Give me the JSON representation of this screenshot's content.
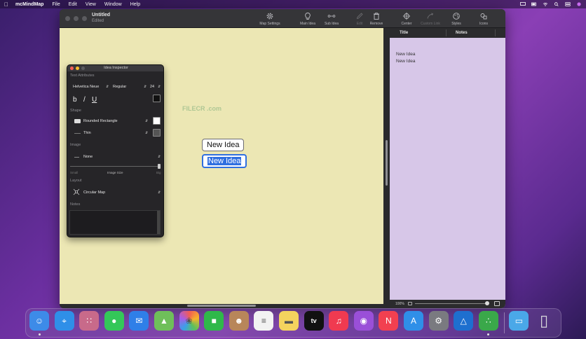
{
  "menubar": {
    "app": "mcMindMap",
    "items": [
      "File",
      "Edit",
      "View",
      "Window",
      "Help"
    ]
  },
  "window": {
    "title": "Untitled",
    "subtitle": "Edited",
    "toolbar": [
      {
        "label": "Map Settings",
        "icon": "gear-icon",
        "enabled": true
      },
      {
        "label": "Main Idea",
        "icon": "lightbulb-icon",
        "enabled": true
      },
      {
        "label": "Sub Idea",
        "icon": "sub-idea-icon",
        "enabled": true
      },
      {
        "label": "Edit",
        "icon": "pen-icon",
        "enabled": false
      },
      {
        "label": "Remove",
        "icon": "trash-icon",
        "enabled": true
      },
      {
        "label": "Center",
        "icon": "crosshair-icon",
        "enabled": true
      },
      {
        "label": "Custom Link",
        "icon": "link-arrow-icon",
        "enabled": false
      },
      {
        "label": "Styles",
        "icon": "palette-icon",
        "enabled": true
      },
      {
        "label": "Icons",
        "icon": "icons-icon",
        "enabled": true
      }
    ]
  },
  "canvas": {
    "nodes": [
      "New Idea",
      "New Idea"
    ],
    "watermark": "FILECR .com",
    "background": "#ece7b4"
  },
  "notes_panel": {
    "columns": [
      "Title",
      "Notes"
    ],
    "rows": [
      "New Idea",
      "New Idea"
    ],
    "zoom": "100%"
  },
  "inspector": {
    "title": "Idea Inspector",
    "text_attributes_label": "Text Attributes",
    "font": "Helvetica Neue",
    "weight": "Regular",
    "size": "24",
    "bold": "b",
    "italic": "/",
    "underline": "U",
    "shape_label": "Shape",
    "shape": "Rounded Rectangle",
    "line": "Thin",
    "image_label": "Image",
    "image": "None",
    "image_size_small": "Small",
    "image_size_label": "Image Size",
    "image_size_big": "Big",
    "layout_label": "Layout",
    "layout": "Circular Map",
    "notes_label": "Notes"
  },
  "dock": [
    {
      "name": "finder",
      "icon": "finder-icon",
      "color": "#3d8be8",
      "running": true
    },
    {
      "name": "safari",
      "icon": "compass-icon",
      "color": "#2f8fe8",
      "running": false
    },
    {
      "name": "launchpad",
      "icon": "grid-icon",
      "color": "#c86a8a",
      "running": false
    },
    {
      "name": "messages",
      "icon": "chat-bubble-icon",
      "color": "#34c759",
      "running": false
    },
    {
      "name": "mail",
      "icon": "envelope-icon",
      "color": "#2f7fe8",
      "running": false
    },
    {
      "name": "maps",
      "icon": "map-pin-icon",
      "color": "#6fbf5a",
      "running": false
    },
    {
      "name": "photos",
      "icon": "flower-icon",
      "color": "#f4f4f4",
      "running": false
    },
    {
      "name": "facetime",
      "icon": "camera-icon",
      "color": "#2fb84a",
      "running": false
    },
    {
      "name": "contacts",
      "icon": "person-icon",
      "color": "#b8865a",
      "running": false
    },
    {
      "name": "reminders",
      "icon": "checklist-icon",
      "color": "#f2f2f2",
      "running": false
    },
    {
      "name": "notes",
      "icon": "note-icon",
      "color": "#f4d35e",
      "running": false
    },
    {
      "name": "tv",
      "icon": "tv-icon",
      "color": "#111111",
      "label": "tv",
      "running": false
    },
    {
      "name": "music",
      "icon": "music-note-icon",
      "color": "#f03a50",
      "running": false
    },
    {
      "name": "podcasts",
      "icon": "podcast-icon",
      "color": "#9a4fd8",
      "running": false
    },
    {
      "name": "news",
      "icon": "news-icon",
      "color": "#f24050",
      "running": false
    },
    {
      "name": "app-store",
      "icon": "appstore-icon",
      "color": "#2f8fe8",
      "running": false
    },
    {
      "name": "system-preferences",
      "icon": "gear-icon",
      "color": "#7a7a80",
      "running": false
    },
    {
      "name": "altimeter",
      "icon": "mountain-icon",
      "color": "#1e6fcf",
      "running": false
    },
    {
      "name": "mcmindmap",
      "icon": "mindmap-icon",
      "color": "#3aa84a",
      "running": true
    },
    {
      "name": "downloads-folder",
      "icon": "folder-icon",
      "color": "#4aa8e8",
      "running": false
    },
    {
      "name": "trash",
      "icon": "trash-icon",
      "color": "#9a9aa0",
      "running": false
    }
  ]
}
